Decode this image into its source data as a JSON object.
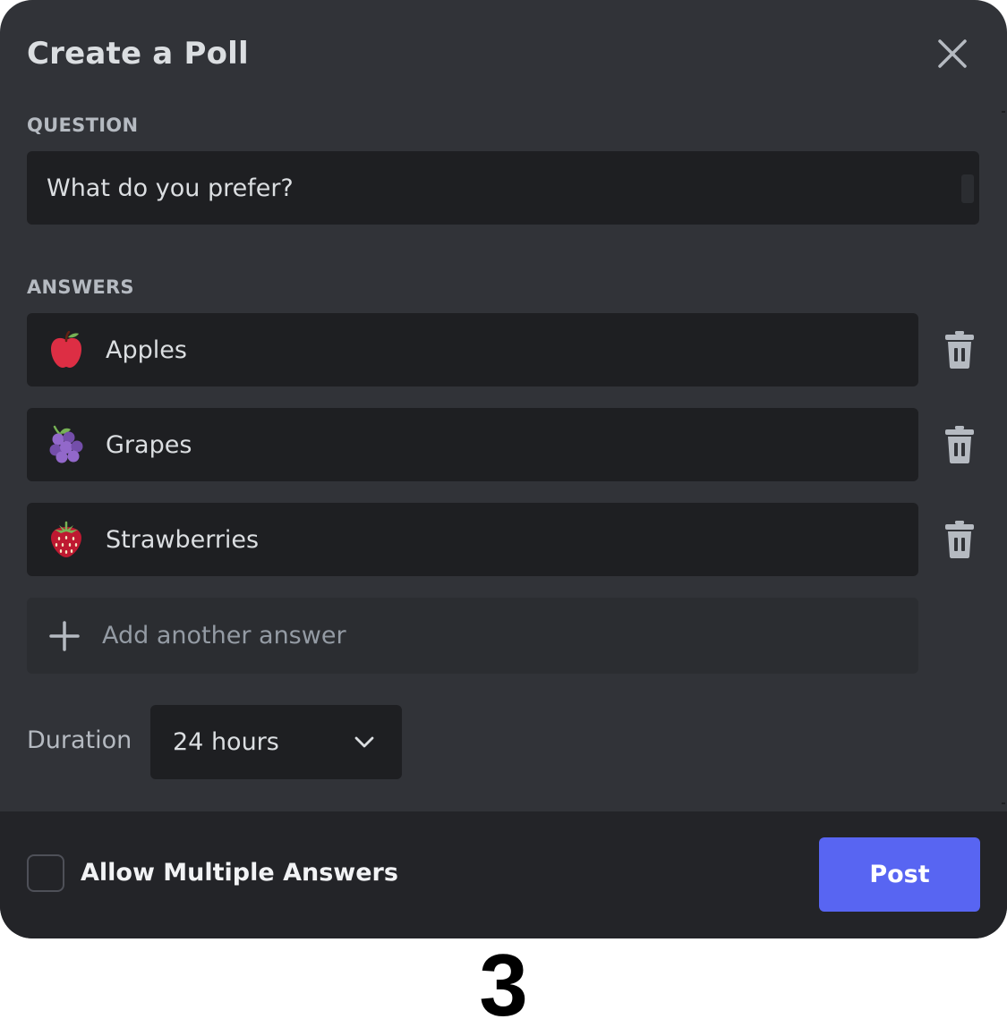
{
  "modal": {
    "title": "Create a Poll",
    "close_icon": "close-icon"
  },
  "question": {
    "label": "QUESTION",
    "value": "What do you prefer?"
  },
  "answers": {
    "label": "ANSWERS",
    "items": [
      {
        "emoji": "apple-icon",
        "text": "Apples"
      },
      {
        "emoji": "grapes-icon",
        "text": "Grapes"
      },
      {
        "emoji": "strawberry-icon",
        "text": "Strawberries"
      }
    ],
    "add_placeholder": "Add another answer"
  },
  "duration": {
    "label": "Duration",
    "selected": "24 hours"
  },
  "footer": {
    "allow_multiple_label": "Allow Multiple Answers",
    "allow_multiple_checked": false,
    "post_label": "Post"
  },
  "step": "3",
  "colors": {
    "modal_bg": "#313338",
    "input_bg": "#1e1f22",
    "footer_bg": "#232428",
    "accent": "#5865f2"
  }
}
